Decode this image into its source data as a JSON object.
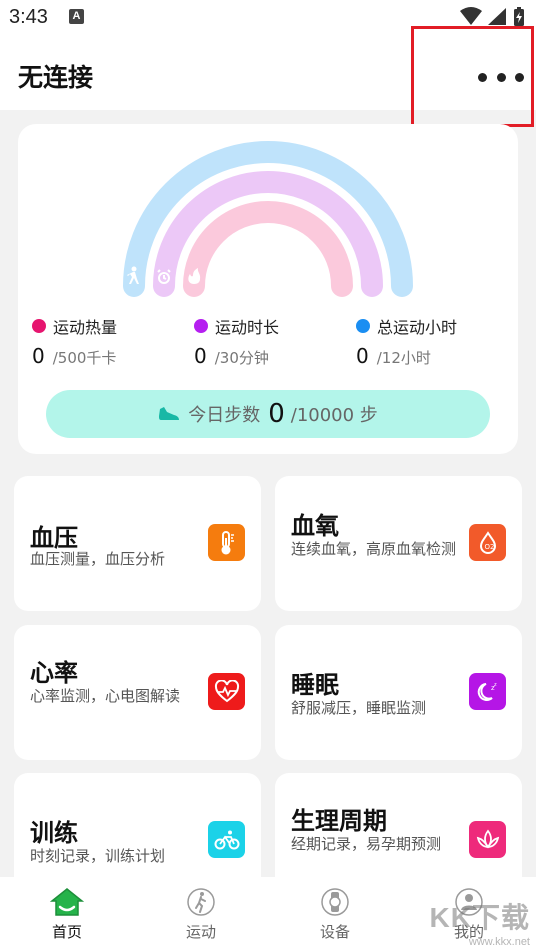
{
  "status_bar": {
    "time": "3:43",
    "notification_icon": "A"
  },
  "app_bar": {
    "title": "无连接",
    "more_icon": "more-horizontal-icon"
  },
  "summary": {
    "legend": [
      {
        "label": "运动热量",
        "value": "0",
        "unit": "/500千卡",
        "color": "#e6156f"
      },
      {
        "label": "运动时长",
        "value": "0",
        "unit": "/30分钟",
        "color": "#b51ff0"
      },
      {
        "label": "总运动小时",
        "value": "0",
        "unit": "/12小时",
        "color": "#1a8ef2"
      }
    ],
    "rainbow_colors": {
      "outer": "#bfe3fb",
      "middle": "#ecc8f7",
      "inner": "#fbc9dc"
    },
    "progress": {
      "calories": 0,
      "duration": 0,
      "hours": 0
    },
    "steps": {
      "label": "今日步数",
      "value": "0",
      "unit": "/10000 步",
      "icon": "shoe-icon"
    }
  },
  "cards": [
    {
      "title": "血压",
      "subtitle": "血压测量，血压分析",
      "icon": "thermometer-icon",
      "color": "#f57c0e"
    },
    {
      "title": "血氧",
      "subtitle": "连续血氧，高原血氧检测",
      "icon": "oxygen-drop-icon",
      "color": "#f25a2a"
    },
    {
      "title": "心率",
      "subtitle": "心率监测，心电图解读",
      "icon": "heart-rate-icon",
      "color": "#ee1b1b"
    },
    {
      "title": "睡眠",
      "subtitle": "舒服减压，睡眠监测",
      "icon": "moon-icon",
      "color": "#b516e6"
    },
    {
      "title": "训练",
      "subtitle": "时刻记录，训练计划",
      "icon": "bicycle-icon",
      "color": "#1bd2e8"
    },
    {
      "title": "生理周期",
      "subtitle": "经期记录，易孕期预测",
      "icon": "lotus-icon",
      "color": "#ee2a7b"
    }
  ],
  "bottom_nav": [
    {
      "label": "首页",
      "icon": "home-icon",
      "active": true
    },
    {
      "label": "运动",
      "icon": "runner-icon",
      "active": false
    },
    {
      "label": "设备",
      "icon": "watch-icon",
      "active": false
    },
    {
      "label": "我的",
      "icon": "profile-icon",
      "active": false
    }
  ],
  "watermark": {
    "brand": "KK下载",
    "url": "www.kkx.net"
  }
}
